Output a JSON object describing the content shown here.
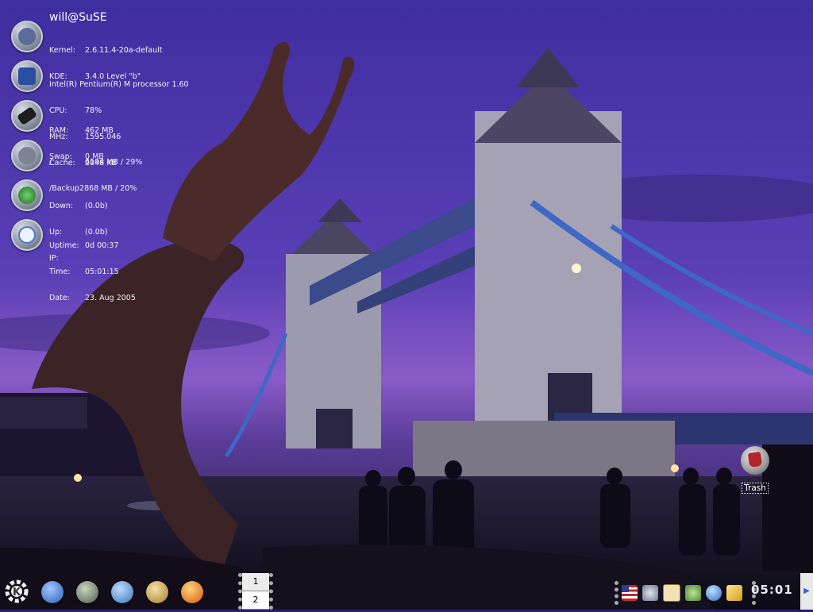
{
  "wallpaper": {
    "scene": "tower-bridge-dusk"
  },
  "sysmon": {
    "host": "will@SuSE",
    "system": {
      "kernel_key": "Kernel:",
      "kernel_val": "2.6.11.4-20a-default",
      "kde_key": "KDE:",
      "kde_val": "3.4.0 Level \"b\""
    },
    "cpu": {
      "model": "Intel(R) Pentium(R) M processor 1.60",
      "cpu_key": "CPU:",
      "cpu_val": "78%",
      "mhz_key": "MHz:",
      "mhz_val": "1595.046",
      "cache_key": "Cache:",
      "cache_val": "2048 KB"
    },
    "memory": {
      "ram_key": "RAM:",
      "ram_val": "462 MB",
      "swap_key": "Swap:",
      "swap_val": "0 MB"
    },
    "disk": {
      "root_key": "/",
      "root_val": "6194 MB / 29%",
      "backup_key": "/Backup",
      "backup_val": "2868 MB / 20%"
    },
    "network": {
      "down_key": "Down:",
      "down_val": "(0.0b)",
      "up_key": "Up:",
      "up_val": "(0.0b)",
      "ip_key": "IP:",
      "ip_val": ""
    },
    "time": {
      "uptime_key": "Uptime:",
      "uptime_val": "0d 00:37",
      "time_key": "Time:",
      "time_val": "05:01:15",
      "date_key": "Date:",
      "date_val": "23. Aug 2005"
    }
  },
  "desktop_icons": [
    {
      "label": "Trash",
      "icon": "trash-icon"
    }
  ],
  "panel": {
    "kmenu_icon": "kde-gear-icon",
    "launchers": [
      {
        "icon": "home-globe-icon",
        "color": "#3d6fc2"
      },
      {
        "icon": "terminal-icon",
        "color": "#5a6b5a"
      },
      {
        "icon": "help-lifebuoy-icon",
        "color": "#4f86c6"
      },
      {
        "icon": "file-manager-icon",
        "color": "#c59a3a"
      },
      {
        "icon": "firefox-icon",
        "color": "#e0701c"
      }
    ],
    "pager": [
      "1",
      "2"
    ],
    "tray_icons": [
      "us-flag-icon",
      "network-icon",
      "klipper-icon",
      "kmix-icon",
      "suse-watcher-icon",
      "kwallet-icon"
    ],
    "clock": "05:01"
  }
}
